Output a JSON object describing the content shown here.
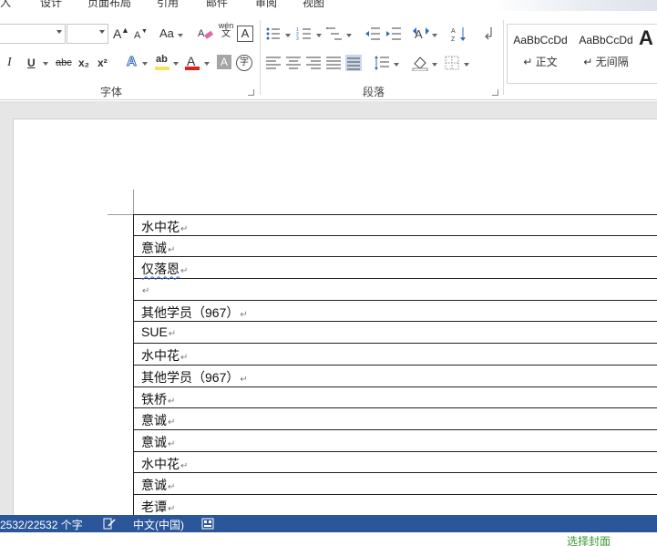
{
  "menu": {
    "tabs": [
      "入",
      "设计",
      "页面布局",
      "引用",
      "邮件",
      "审阅",
      "视图"
    ]
  },
  "ribbon": {
    "font_group_label": "字体",
    "paragraph_group_label": "段落",
    "font_size_increase": "A",
    "font_size_decrease": "A",
    "change_case": "Aa",
    "phonetic_top": "wén",
    "phonetic_bottom": "文",
    "char_border": "A",
    "italic": "I",
    "underline": "U",
    "strikethrough": "abc",
    "subscript": "x₂",
    "superscript": "x²",
    "text_effect": "A",
    "highlight": "ab",
    "font_color": "A",
    "char_shading": "A",
    "enclose_char": "字",
    "styles": [
      {
        "sample": "AaBbCcDd",
        "name": "↵ 正文"
      },
      {
        "sample": "AaBbCcDd",
        "name": "↵ 无间隔"
      },
      {
        "sample": "A",
        "name": ""
      }
    ]
  },
  "table": {
    "rows": [
      {
        "text": "水中花",
        "mark": "↵"
      },
      {
        "text": "意诚",
        "mark": "↵"
      },
      {
        "text": "仅落恩",
        "mark": "↵",
        "squiggle": true
      },
      {
        "text": "",
        "mark": "↵"
      },
      {
        "text": "其他学员（967）",
        "mark": "↵"
      },
      {
        "text": "SUE",
        "mark": "↵"
      },
      {
        "text": "水中花",
        "mark": "↵"
      },
      {
        "text": "其他学员（967）",
        "mark": "↵"
      },
      {
        "text": "铁桥",
        "mark": "↵"
      },
      {
        "text": "意诚",
        "mark": "↵"
      },
      {
        "text": "意诚",
        "mark": "↵"
      },
      {
        "text": "水中花",
        "mark": "↵"
      },
      {
        "text": "意诚",
        "mark": "↵"
      },
      {
        "text": "老谭",
        "mark": "↵"
      }
    ]
  },
  "status": {
    "word_count": "2532/22532 个字",
    "language": "中文(中国)"
  },
  "bottom": {
    "cover_link": "选择封面"
  },
  "colors": {
    "status_bar": "#2b579a",
    "highlight": "#f6e35a",
    "font_color_bar": "#e0201e",
    "spelling_squiggle": "#3b6fd0"
  }
}
